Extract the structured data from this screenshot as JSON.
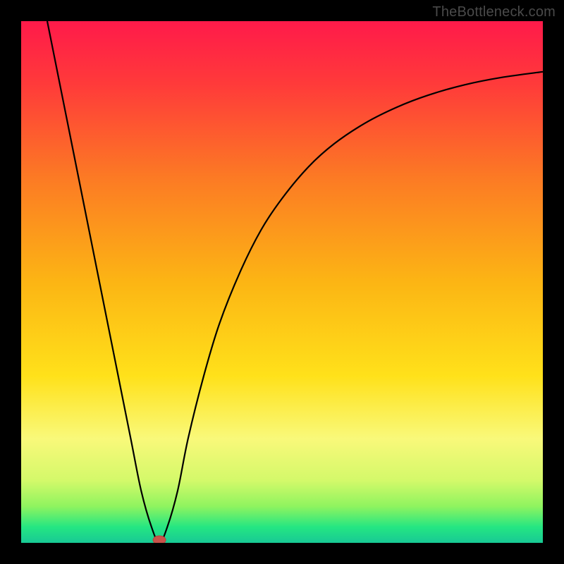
{
  "watermark": "TheBottleneck.com",
  "chart_data": {
    "type": "line",
    "title": "",
    "xlabel": "",
    "ylabel": "",
    "xlim": [
      0,
      100
    ],
    "ylim": [
      0,
      100
    ],
    "grid": false,
    "legend": null,
    "gradient_stops": [
      {
        "t": 0.0,
        "color": "#ff1a4a"
      },
      {
        "t": 0.12,
        "color": "#ff3a3a"
      },
      {
        "t": 0.3,
        "color": "#fc7a24"
      },
      {
        "t": 0.5,
        "color": "#fcb514"
      },
      {
        "t": 0.68,
        "color": "#ffe11a"
      },
      {
        "t": 0.8,
        "color": "#f9f97a"
      },
      {
        "t": 0.88,
        "color": "#d4f96a"
      },
      {
        "t": 0.93,
        "color": "#8ff45f"
      },
      {
        "t": 0.97,
        "color": "#24e682"
      },
      {
        "t": 1.0,
        "color": "#18c995"
      }
    ],
    "series": [
      {
        "name": "bottleneck-curve",
        "x": [
          5,
          7,
          9,
          12,
          15,
          18,
          21,
          23,
          25,
          26.5,
          28,
          30,
          32,
          35,
          38,
          42,
          46,
          50,
          55,
          60,
          66,
          72,
          78,
          85,
          92,
          100
        ],
        "y": [
          100,
          90,
          80,
          65,
          50,
          35,
          20,
          10,
          3,
          0,
          3,
          10,
          20,
          32,
          42,
          52,
          60,
          66,
          72,
          76.5,
          80.5,
          83.5,
          85.8,
          87.8,
          89.2,
          90.3
        ]
      }
    ],
    "marker": {
      "x": 26.5,
      "y": 0,
      "color": "#c9524a"
    }
  }
}
